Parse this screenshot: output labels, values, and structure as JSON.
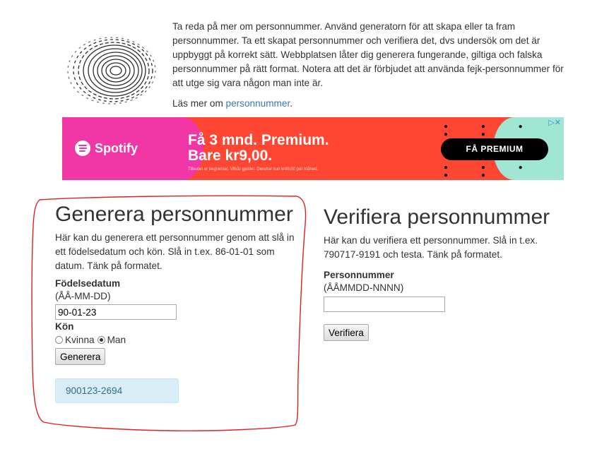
{
  "intro": {
    "text": "Ta reda på mer om personnummer. Använd generatorn för att skapa eller ta fram personnummer. Ta ett skapat personnummer och verifiera det, dvs undersök om det är uppbyggt på korrekt sätt. Webbplatsen låter dig generera fungerande, giltiga och falska personnummer på rätt format. Notera att det är förbjudet att använda fejk-personnummer för att utge sig vara någon man inte är.",
    "more_prefix": "Läs mer om ",
    "more_link": "personnummer",
    "more_suffix": "."
  },
  "ad": {
    "brand": "Spotify",
    "headline_1": "Få 3 mnd. Premium.",
    "headline_2": "Bare kr9,00.",
    "fine_print": "Tilbudet er begrenset. Vilkår gjelder. Deretter kun kr99,00 per måned.",
    "cta": "FÅ PREMIUM",
    "colors": {
      "pink": "#f037a5",
      "red": "#ff4632",
      "mint": "#a0e6d2"
    }
  },
  "generate": {
    "title": "Generera personnummer",
    "description": "Här kan du generera ett personnummer genom att slå in ett födelsedatum och kön. Slå in t.ex. 86-01-01 som datum. Tänk på formatet.",
    "date_label": "Födelsedatum",
    "date_hint": "(ÅÅ-MM-DD)",
    "date_value": "90-01-23",
    "gender_label": "Kön",
    "female_label": "Kvinna",
    "male_label": "Man",
    "selected_gender": "Man",
    "button_label": "Generera",
    "result": "900123-2694"
  },
  "verify": {
    "title": "Verifiera personnummer",
    "description": "Här kan du verifiera ett personnummer. Slå in t.ex. 790717-9191 och testa. Tänk på formatet.",
    "field_label": "Personnummer",
    "field_hint": "(ÅÅMMDD-NNNN)",
    "field_value": "",
    "button_label": "Verifiera"
  },
  "colors": {
    "link": "#337ab7",
    "result_bg": "#d9edf7",
    "result_text": "#31708f",
    "annotation": "#e02020"
  }
}
